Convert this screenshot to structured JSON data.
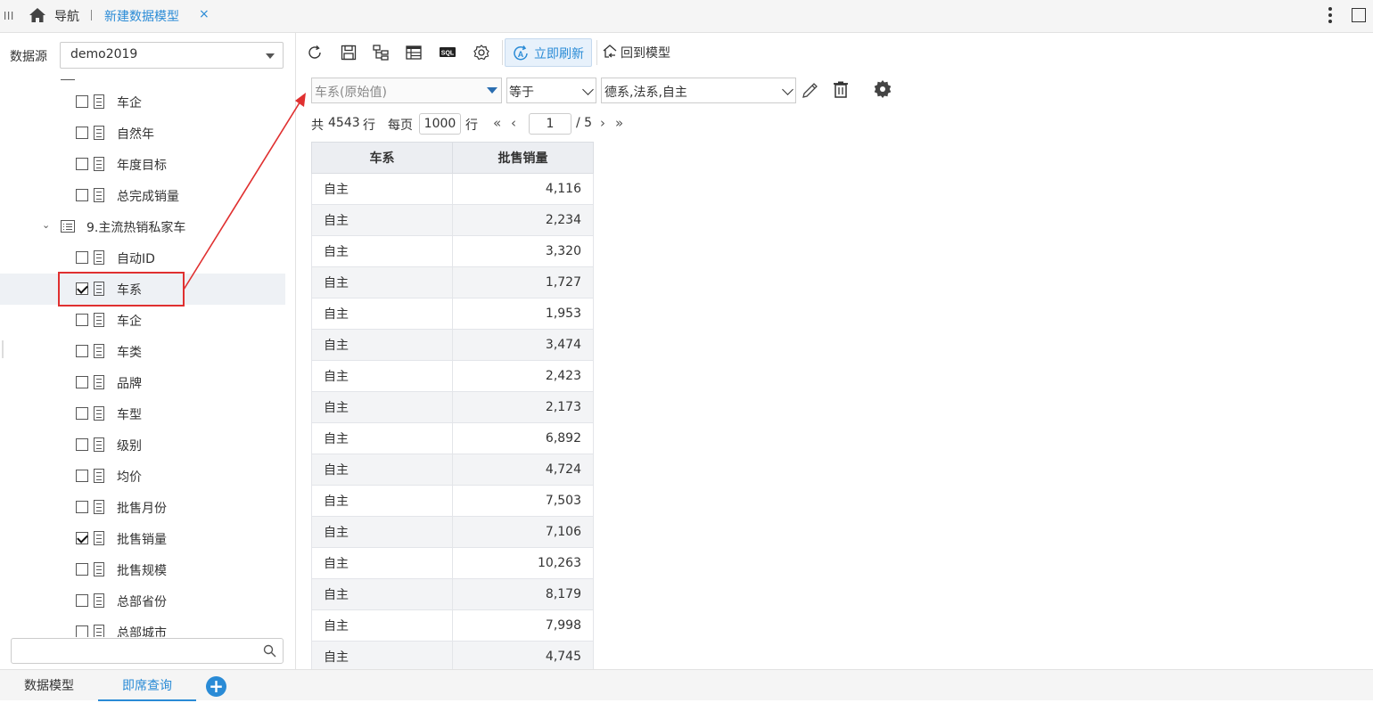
{
  "topbar": {
    "nav_label": "导航",
    "active_tab": "新建数据模型",
    "close_glyph": "×"
  },
  "sidebar": {
    "datasource_label": "数据源",
    "datasource_value": "demo2019",
    "tree": [
      {
        "type": "field",
        "label": "车企",
        "checked": false
      },
      {
        "type": "field",
        "label": "自然年",
        "checked": false
      },
      {
        "type": "field",
        "label": "年度目标",
        "checked": false
      },
      {
        "type": "field",
        "label": "总完成销量",
        "checked": false
      },
      {
        "type": "table",
        "label": "9.主流热销私家车",
        "expanded": true
      },
      {
        "type": "field",
        "label": "自动ID",
        "checked": false
      },
      {
        "type": "field",
        "label": "车系",
        "checked": true,
        "selected": true
      },
      {
        "type": "field",
        "label": "车企",
        "checked": false
      },
      {
        "type": "field",
        "label": "车类",
        "checked": false
      },
      {
        "type": "field",
        "label": "品牌",
        "checked": false
      },
      {
        "type": "field",
        "label": "车型",
        "checked": false
      },
      {
        "type": "field",
        "label": "级别",
        "checked": false
      },
      {
        "type": "field",
        "label": "均价",
        "checked": false
      },
      {
        "type": "field",
        "label": "批售月份",
        "checked": false
      },
      {
        "type": "field",
        "label": "批售销量",
        "checked": true
      },
      {
        "type": "field",
        "label": "批售规模",
        "checked": false
      },
      {
        "type": "field",
        "label": "总部省份",
        "checked": false
      },
      {
        "type": "field",
        "label": "总部城市",
        "checked": false
      }
    ],
    "search_placeholder": ""
  },
  "toolbar": {
    "refresh_now": "立即刷新",
    "back_to_model": "回到模型",
    "sql_label": "SQL"
  },
  "filter": {
    "field_placeholder": "车系(原始值)",
    "operator": "等于",
    "value": "德系,法系,自主"
  },
  "pager": {
    "total_prefix": "共",
    "total_rows": "4543",
    "rows_unit": "行",
    "per_page_label": "每页",
    "per_page": "1000",
    "current_page": "1",
    "total_pages": "/ 5"
  },
  "table": {
    "headers": [
      "车系",
      "批售销量"
    ],
    "rows": [
      [
        "自主",
        "4,116"
      ],
      [
        "自主",
        "2,234"
      ],
      [
        "自主",
        "3,320"
      ],
      [
        "自主",
        "1,727"
      ],
      [
        "自主",
        "1,953"
      ],
      [
        "自主",
        "3,474"
      ],
      [
        "自主",
        "2,423"
      ],
      [
        "自主",
        "2,173"
      ],
      [
        "自主",
        "6,892"
      ],
      [
        "自主",
        "4,724"
      ],
      [
        "自主",
        "7,503"
      ],
      [
        "自主",
        "7,106"
      ],
      [
        "自主",
        "10,263"
      ],
      [
        "自主",
        "8,179"
      ],
      [
        "自主",
        "7,998"
      ],
      [
        "自主",
        "4,745"
      ]
    ]
  },
  "bottom_tabs": [
    "数据模型",
    "即席查询"
  ],
  "colors": {
    "accent": "#2a8bd6",
    "annotation": "#e03030"
  }
}
